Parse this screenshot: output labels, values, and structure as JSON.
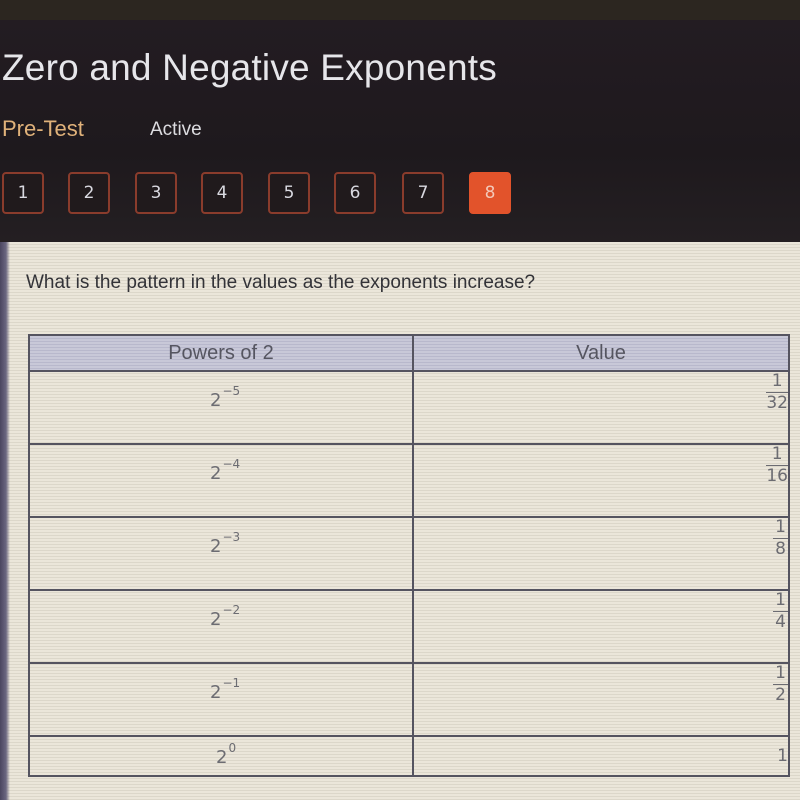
{
  "header": {
    "title": "Zero and Negative Exponents",
    "section": "Pre-Test",
    "status": "Active"
  },
  "question_nav": {
    "items": [
      "1",
      "2",
      "3",
      "4",
      "5",
      "6",
      "7",
      "8"
    ],
    "current": "8"
  },
  "colors": {
    "accent": "#e2532b",
    "section_label": "#e0b27a",
    "header_bg": "#1f1a1e",
    "content_bg": "#ebe6da",
    "table_header_bg": "#c8c8d8"
  },
  "question": {
    "text": "What is the pattern in the values as the exponents increase?"
  },
  "table": {
    "headers": [
      "Powers of 2",
      "Value"
    ],
    "rows": [
      {
        "base": "2",
        "exponent": "−5",
        "value_num": "1",
        "value_den": "32"
      },
      {
        "base": "2",
        "exponent": "−4",
        "value_num": "1",
        "value_den": "16"
      },
      {
        "base": "2",
        "exponent": "−3",
        "value_num": "1",
        "value_den": "8"
      },
      {
        "base": "2",
        "exponent": "−2",
        "value_num": "1",
        "value_den": "4"
      },
      {
        "base": "2",
        "exponent": "−1",
        "value_num": "1",
        "value_den": "2"
      },
      {
        "base": "2",
        "exponent": "0",
        "value_whole": "1"
      }
    ]
  }
}
